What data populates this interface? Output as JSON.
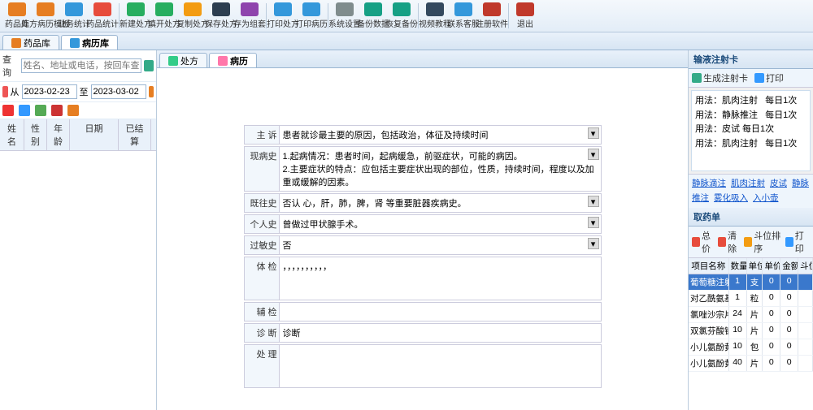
{
  "toolbar": [
    {
      "name": "drug-lib",
      "label": "药品库",
      "color": "#e67e22"
    },
    {
      "name": "record-template",
      "label": "处方病历模板",
      "color": "#e67e22"
    },
    {
      "name": "biz-stats",
      "label": "业务统计",
      "color": "#3498db"
    },
    {
      "name": "drug-stats",
      "label": "药品统计",
      "color": "#e74c3c"
    },
    {
      "name": "new-rx",
      "label": "新建处方",
      "color": "#27ae60"
    },
    {
      "name": "edit-rx",
      "label": "填开处方",
      "color": "#27ae60"
    },
    {
      "name": "copy-rx",
      "label": "复制处方",
      "color": "#f39c12"
    },
    {
      "name": "save-rx",
      "label": "保存处方",
      "color": "#2c3e50"
    },
    {
      "name": "save-group",
      "label": "存为组套",
      "color": "#8e44ad"
    },
    {
      "name": "print-rx",
      "label": "打印处方",
      "color": "#3498db"
    },
    {
      "name": "print-record",
      "label": "打印病历",
      "color": "#3498db"
    },
    {
      "name": "sys-settings",
      "label": "系统设置",
      "color": "#7f8c8d"
    },
    {
      "name": "backup",
      "label": "备份数据",
      "color": "#16a085"
    },
    {
      "name": "restore",
      "label": "恢复备份",
      "color": "#16a085"
    },
    {
      "name": "video-tutorial",
      "label": "视频教程",
      "color": "#34495e"
    },
    {
      "name": "contact",
      "label": "联系客服",
      "color": "#3498db"
    },
    {
      "name": "register",
      "label": "注册软件",
      "color": "#c0392b"
    },
    {
      "name": "exit",
      "label": "退出",
      "color": "#c0392b"
    }
  ],
  "main_tabs": [
    {
      "name": "tab-druglib",
      "label": "药品库",
      "icon": "#e67e22"
    },
    {
      "name": "tab-recordlib",
      "label": "病历库",
      "icon": "#3498db",
      "active": true
    }
  ],
  "search": {
    "label": "查询",
    "placeholder": "姓名、地址或电话，按回车查询",
    "from_label": "从",
    "date_from": "2023-02-23",
    "to_label": "至",
    "date_to": "2023-03-02"
  },
  "list_headers": [
    "姓名",
    "性别",
    "年龄",
    "日期",
    "已结算"
  ],
  "center_tabs": [
    {
      "name": "tab-rx",
      "label": "处方",
      "icon": "#3c8"
    },
    {
      "name": "tab-record",
      "label": "病历",
      "icon": "#f7a",
      "active": true
    }
  ],
  "form": {
    "chief_label": "主 诉",
    "chief": "患者就诊最主要的原因，包括政治，体征及持续时间",
    "present_label": "现病史",
    "present": "1.起病情况：患者时间，起病缓急，前驱症状，可能的病因。\n2.主要症状的特点：应包括主要症状出现的部位，性质，持续时间，程度以及加重或缓解的因素。",
    "past_label": "既往史",
    "past": "否认 心，肝，肺，脾，肾 等重要脏器疾病史。",
    "personal_label": "个人史",
    "personal": "曾做过甲状腺手术。",
    "allergy_label": "过敏史",
    "allergy": "否",
    "exam_label": "体 检",
    "exam": "，，，，，，，，，，",
    "aux_label": "辅 检",
    "aux": "",
    "diag_label": "诊 断",
    "diag": "诊断",
    "treat_label": "处 理",
    "treat": ""
  },
  "injection_card": {
    "title": "输液注射卡",
    "gen_label": "生成注射卡",
    "print_label": "打印",
    "lines": [
      "用法：肌肉注射   每日1次",
      "用法：静脉推注   每日1次",
      "用法：皮试 每日1次",
      "用法：肌肉注射   每日1次"
    ]
  },
  "links": [
    "静脉滴注",
    "肌肉注射",
    "皮试",
    "静脉推注",
    "雾化吸入",
    "入小壶"
  ],
  "drug_list": {
    "title": "取药单",
    "btns": {
      "sum": "总价",
      "clear": "清除",
      "sort": "斗位排序",
      "print": "打印"
    },
    "headers": [
      "项目名称",
      "数量",
      "单位",
      "单价",
      "金额",
      "斗位"
    ],
    "rows": [
      {
        "name": "葡萄糖注射液",
        "qty": "1",
        "unit": "支",
        "price": "0",
        "amt": "0",
        "pos": "",
        "sel": true
      },
      {
        "name": "对乙酰氨基…",
        "qty": "1",
        "unit": "粒",
        "price": "0",
        "amt": "0",
        "pos": ""
      },
      {
        "name": "氯唑沙宗片",
        "qty": "24",
        "unit": "片",
        "price": "0",
        "amt": "0",
        "pos": ""
      },
      {
        "name": "双氯芬酸钠…",
        "qty": "10",
        "unit": "片",
        "price": "0",
        "amt": "0",
        "pos": ""
      },
      {
        "name": "小儿氨酚黄…",
        "qty": "10",
        "unit": "包",
        "price": "0",
        "amt": "0",
        "pos": ""
      },
      {
        "name": "小儿氨酚黄…",
        "qty": "40",
        "unit": "片",
        "price": "0",
        "amt": "0",
        "pos": ""
      }
    ]
  }
}
